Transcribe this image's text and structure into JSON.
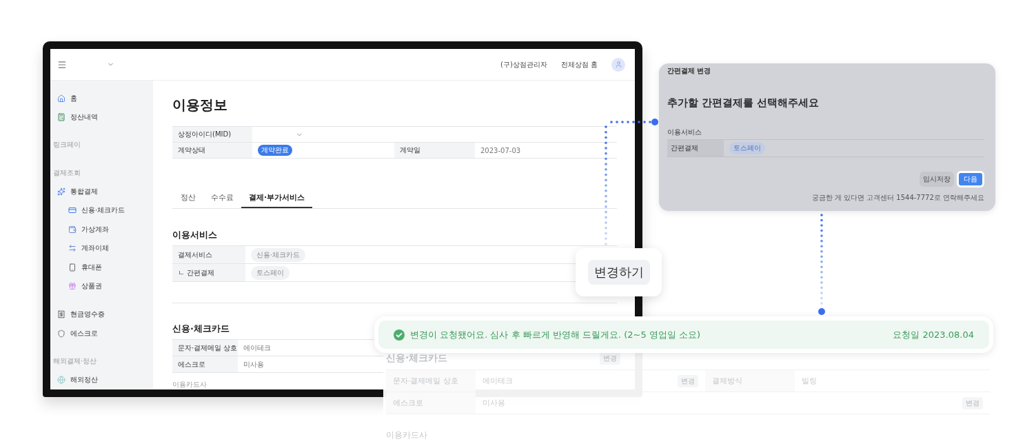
{
  "monitor": {
    "header": {
      "links": [
        "(구)상점관리자",
        "전체상점 홈"
      ]
    },
    "sidebar": {
      "items": [
        {
          "kind": "item",
          "label": "홈"
        },
        {
          "kind": "item",
          "label": "정산내역"
        },
        {
          "kind": "section",
          "label": "링크페이"
        },
        {
          "kind": "section",
          "label": "결제조회"
        },
        {
          "kind": "item",
          "label": "통합결제"
        },
        {
          "kind": "subitem",
          "label": "신용·체크카드"
        },
        {
          "kind": "subitem",
          "label": "가상계좌"
        },
        {
          "kind": "subitem",
          "label": "계좌이체"
        },
        {
          "kind": "subitem",
          "label": "휴대폰"
        },
        {
          "kind": "subitem",
          "label": "상품권"
        },
        {
          "kind": "item",
          "label": "현금영수증"
        },
        {
          "kind": "item",
          "label": "에스크로"
        },
        {
          "kind": "section",
          "label": "해외결제·정산"
        },
        {
          "kind": "item",
          "label": "해외정산"
        }
      ]
    },
    "title": "이용정보",
    "contract": {
      "mid_label": "상정아이디(MID)",
      "status_label": "계약상태",
      "status": "계약완료",
      "date_label": "계약일",
      "date": "2023-07-03"
    },
    "tabs": [
      {
        "label": "정산",
        "selected": false
      },
      {
        "label": "수수료",
        "selected": false
      },
      {
        "label": "결제·부가서비스",
        "selected": true
      }
    ],
    "services": {
      "title": "이용서비스",
      "rows": [
        {
          "label": "결제서비스",
          "value": "신용·체크카드"
        },
        {
          "label": "ㄴ 간편결제",
          "value": "토스페이"
        }
      ]
    },
    "card": {
      "title": "신용·체크카드",
      "rows": [
        {
          "label": "문자·결제메일 상호",
          "value": "에이테크"
        },
        {
          "label": "에스크로",
          "value": "미사용"
        }
      ],
      "footer": "이용카드사"
    }
  },
  "change_button": "변경하기",
  "modal": {
    "title": "간편결제 변경",
    "heading": "추가할 간편결제를 선택해주세요",
    "section": "이용서비스",
    "row": {
      "label": "간편결제",
      "value": "토스페이"
    },
    "buttons": [
      {
        "kind": "secondary",
        "label": "임시저장"
      },
      {
        "kind": "primary",
        "label": "다음"
      }
    ],
    "help": "궁금한 게 있다면 고객센터 1544-7772로 연락해주세요"
  },
  "toast": {
    "message": "변경이 요청됐어요. 심사 후 빠르게 반영해 드릴게요. (2~5 영업일 소요)",
    "date": "요청일 2023.08.04"
  },
  "faded_card": {
    "title": "신용·체크카드",
    "title_action": "변경",
    "rows": [
      {
        "label": "문자·결제메일 상호",
        "value": "에이테크",
        "action": "변경",
        "label2": "결제방식",
        "value2": "빌링"
      },
      {
        "label": "에스크로",
        "value": "미사용",
        "action": "변경"
      }
    ],
    "footer": "이용카드사"
  }
}
